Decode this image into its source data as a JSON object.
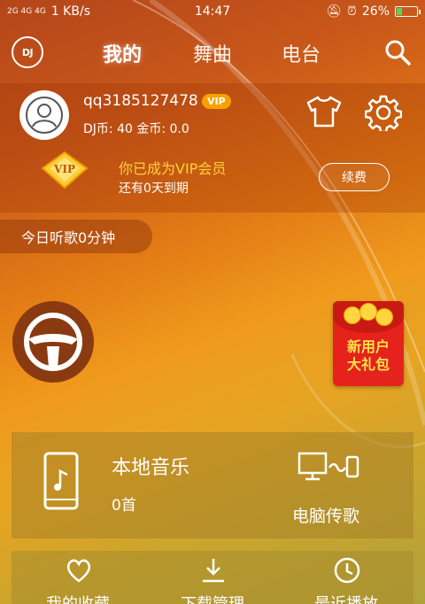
{
  "status_bar": {
    "signal_text": "2G 4G 4G",
    "network_speed": "1 KB/s",
    "time": "14:47",
    "battery_percent": "26%"
  },
  "nav": {
    "logo_text": "DJ",
    "tabs": [
      {
        "label": "我的",
        "active": true
      },
      {
        "label": "舞曲",
        "active": false
      },
      {
        "label": "电台",
        "active": false
      }
    ]
  },
  "profile": {
    "username": "qq3185127478",
    "vip_badge": "VIP",
    "coins": "DJ币: 40 金币: 0.0",
    "vip_gem_label": "VIP",
    "vip_status": "你已成为VIP会员",
    "vip_expire": "还有0天到期",
    "renew_label": "续费"
  },
  "listen_time": "今日听歌0分钟",
  "promo": {
    "line1": "新用户",
    "line2": "大礼包"
  },
  "local_music": {
    "title": "本地音乐",
    "count": "0首",
    "pc_transfer_label": "电脑传歌"
  },
  "bottom_menu": [
    {
      "label": "我的收藏",
      "icon": "heart-icon"
    },
    {
      "label": "下载管理",
      "icon": "download-icon"
    },
    {
      "label": "最近播放",
      "icon": "clock-icon"
    }
  ],
  "colors": {
    "vip_gold": "#ffd23a",
    "vip_badge_bg": "#f7a100",
    "promo_red": "#e5231c"
  }
}
